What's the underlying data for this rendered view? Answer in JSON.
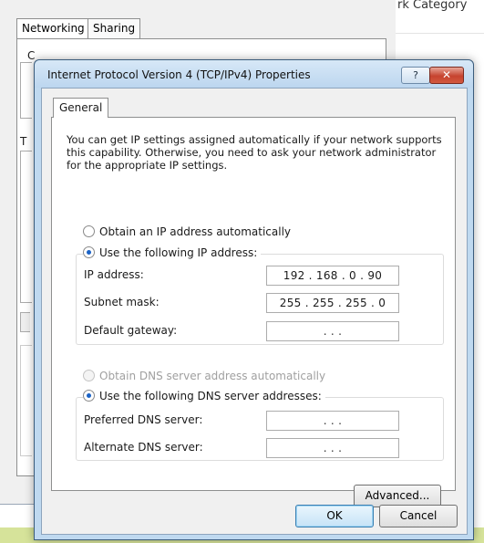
{
  "background": {
    "tabs": [
      "Networking",
      "Sharing"
    ],
    "right_header": "rk Category",
    "fragment_c": "C",
    "fragment_t": "T"
  },
  "dialog": {
    "title": "Internet Protocol Version 4 (TCP/IPv4) Properties",
    "help_glyph": "?",
    "close_glyph": "✕",
    "tab": "General",
    "description": "You can get IP settings assigned automatically if your network supports this capability. Otherwise, you need to ask your network administrator for the appropriate IP settings.",
    "ip": {
      "auto_label": "Obtain an IP address automatically",
      "manual_label": "Use the following IP address:",
      "selected": "manual",
      "fields": [
        {
          "label": "IP address:",
          "value": "192 . 168 . 0 . 90"
        },
        {
          "label": "Subnet mask:",
          "value": "255 . 255 . 255 . 0"
        },
        {
          "label": "Default gateway:",
          "value": ".    .    ."
        }
      ]
    },
    "dns": {
      "auto_label": "Obtain DNS server address automatically",
      "manual_label": "Use the following DNS server addresses:",
      "selected": "manual",
      "auto_disabled": true,
      "fields": [
        {
          "label": "Preferred DNS server:",
          "value": ".    .    ."
        },
        {
          "label": "Alternate DNS server:",
          "value": ".    .    ."
        }
      ]
    },
    "advanced_button": "Advanced...",
    "ok_button": "OK",
    "cancel_button": "Cancel"
  },
  "colors": {
    "title_bar": "#bfd9f0",
    "close_button": "#c6432f",
    "radio_selected": "#1b63c6",
    "taskbar_strip": "#d6e39a"
  }
}
